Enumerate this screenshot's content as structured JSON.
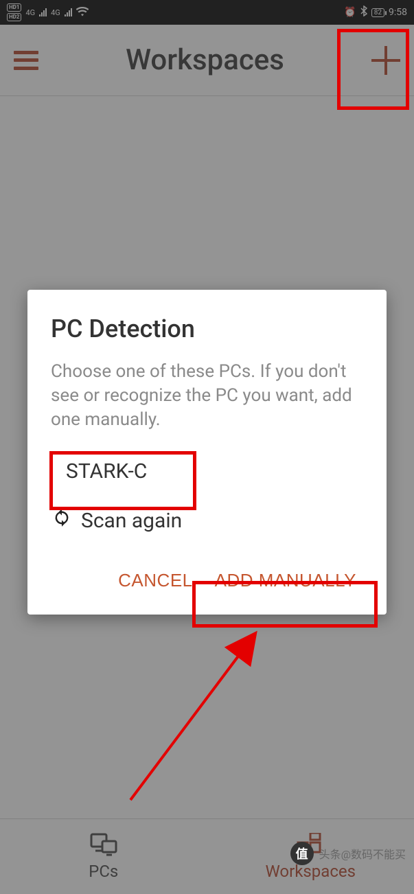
{
  "status_bar": {
    "hd1": "HD1",
    "hd2": "HD2",
    "net1": "4G",
    "net2": "4G",
    "battery": "82",
    "time": "9:58"
  },
  "header": {
    "title": "Workspaces"
  },
  "dialog": {
    "title": "PC Detection",
    "description": "Choose one of these PCs. If you don't see or recognize the PC you want, add one manually.",
    "pcs": [
      "STARK-C"
    ],
    "scan_again_label": "Scan again",
    "cancel_label": "CANCEL",
    "add_manually_label": "ADD MANUALLY"
  },
  "tabs": {
    "pcs_label": "PCs",
    "workspaces_label": "Workspaces"
  },
  "watermark": {
    "badge": "值",
    "text": "头条@数码不能买"
  },
  "colors": {
    "accent": "#b14027",
    "dialog_accent": "#c5562f",
    "annotation": "#e30000"
  }
}
